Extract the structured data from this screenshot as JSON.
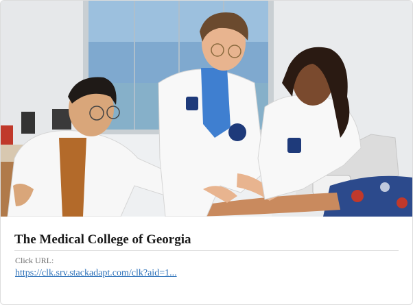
{
  "card": {
    "image_alt": "Medical students in white coats practicing on a simulation patient",
    "title": "The Medical College of Georgia",
    "url_label": "Click URL:",
    "url_text": "https://clk.srv.stackadapt.com/clk?aid=1..."
  },
  "colors": {
    "link": "#2a6fb8",
    "title": "#1a1a1a",
    "label": "#6b6b6b",
    "border": "#dcdcdc"
  }
}
